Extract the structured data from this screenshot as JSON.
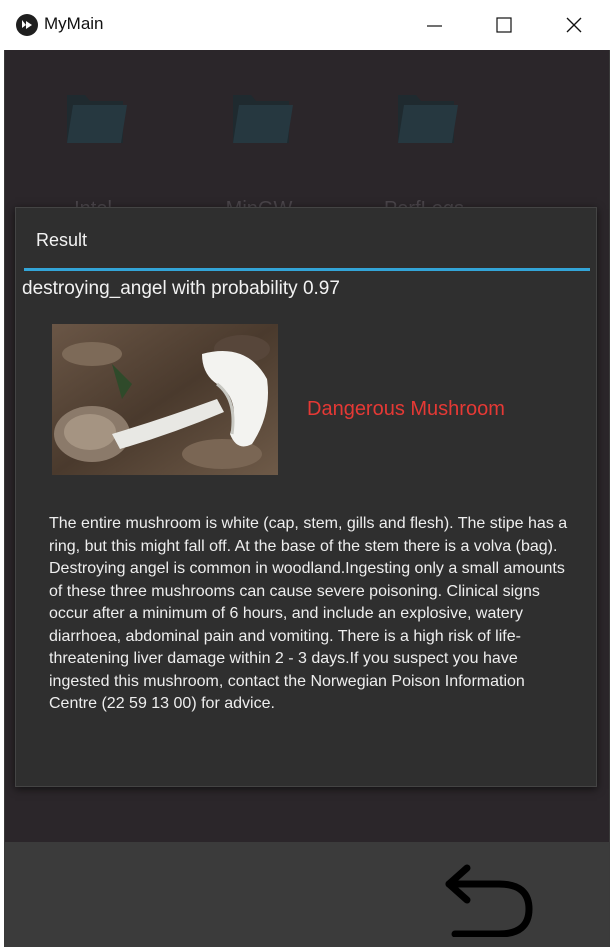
{
  "window": {
    "title": "MyMain"
  },
  "folders": [
    {
      "label": "Intel"
    },
    {
      "label": "MinGW"
    },
    {
      "label": "PerfLogs"
    }
  ],
  "dialog": {
    "title": "Result",
    "prediction": "destroying_angel with probability 0.97",
    "warning": "Dangerous Mushroom",
    "warning_color": "#e53935",
    "description": "The entire mushroom is white (cap, stem, gills and flesh). The stipe has a ring, but this might fall off. At the base of the stem there is a volva (bag). Destroying angel is common in woodland.Ingesting only a small amounts of these three mushrooms can cause severe poisoning. Clinical signs occur after a minimum of 6 hours, and include an explosive, watery diarrhoea, abdominal pain and vomiting. There is a high risk of life-threatening liver damage within 2 - 3 days.If you suspect you have ingested this mushroom, contact the Norwegian Poison Information Centre (22 59 13 00) for advice."
  },
  "icons": {
    "app": "app-icon",
    "minimize": "minimize-icon",
    "maximize": "maximize-icon",
    "close": "close-icon",
    "folder": "folder-icon",
    "back": "back-arrow-icon"
  },
  "colors": {
    "accent": "#33a5d8",
    "background": "#2b262a",
    "dialog": "#2f2f2f"
  }
}
